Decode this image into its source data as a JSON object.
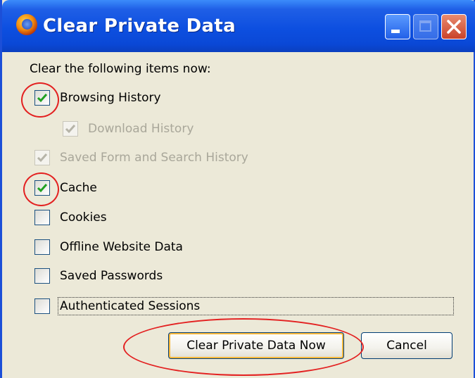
{
  "window": {
    "title": "Clear Private Data",
    "icon": "firefox-icon"
  },
  "dialog": {
    "heading": "Clear the following items now:",
    "options": [
      {
        "label": "Browsing History",
        "checked": true,
        "enabled": true
      },
      {
        "label": "Download History",
        "checked": true,
        "enabled": false
      },
      {
        "label": "Saved Form and Search History",
        "checked": true,
        "enabled": false
      },
      {
        "label": "Cache",
        "checked": true,
        "enabled": true
      },
      {
        "label": "Cookies",
        "checked": false,
        "enabled": true
      },
      {
        "label": "Offline Website Data",
        "checked": false,
        "enabled": true
      },
      {
        "label": "Saved Passwords",
        "checked": false,
        "enabled": true
      },
      {
        "label": "Authenticated Sessions",
        "checked": false,
        "enabled": true
      }
    ],
    "buttons": {
      "clear_now": "Clear Private Data Now",
      "cancel": "Cancel"
    }
  },
  "colors": {
    "accent": "#0a48d6",
    "annotation": "#e32020",
    "check": "#21a121"
  }
}
